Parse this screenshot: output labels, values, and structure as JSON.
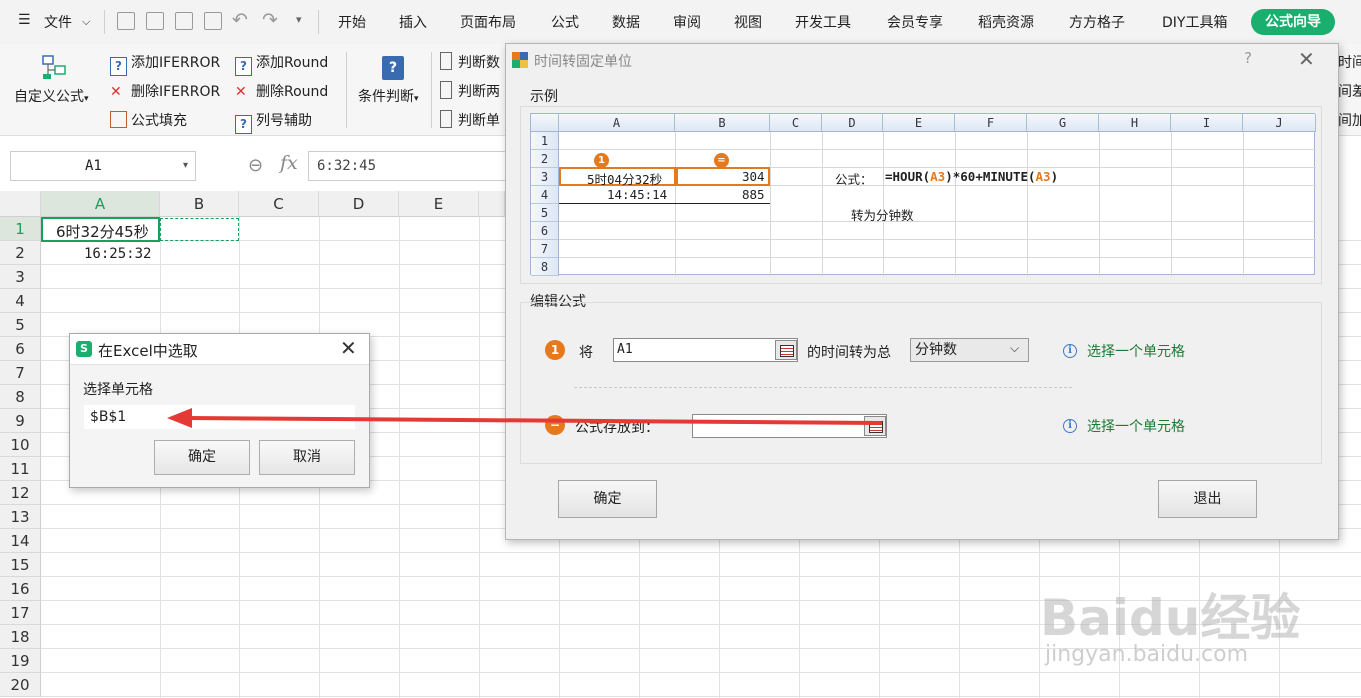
{
  "menubar": {
    "file": "文件",
    "tabs": [
      "开始",
      "插入",
      "页面布局",
      "公式",
      "数据",
      "审阅",
      "视图",
      "开发工具",
      "会员专享",
      "稻壳资源",
      "方方格子",
      "DIY工具箱"
    ],
    "active_tab": "公式向导",
    "accent_color": "#1aae6f"
  },
  "ribbon": {
    "custom_formula": "自定义公式",
    "add_iferror": "添加IFERROR",
    "del_iferror": "删除IFERROR",
    "formula_fill": "公式填充",
    "add_round": "添加Round",
    "del_round": "删除Round",
    "col_helper": "列号辅助",
    "condition": "条件判断",
    "judge1": "判断数",
    "judge2": "判断两",
    "judge3": "判断单",
    "right1": "时间",
    "right2": "间差",
    "right3": "间加"
  },
  "formula_bar": {
    "name_box": "A1",
    "formula": "6:32:45"
  },
  "sheet": {
    "columns": [
      "A",
      "B",
      "C",
      "D",
      "E"
    ],
    "rows": [
      "1",
      "2",
      "3",
      "4",
      "5",
      "6",
      "7",
      "8",
      "9",
      "10",
      "11",
      "12",
      "13",
      "14",
      "15",
      "16",
      "17",
      "18",
      "19",
      "20"
    ],
    "a1": "6时32分45秒",
    "a2": "16:25:32"
  },
  "dialog_main": {
    "title": "时间转固定单位",
    "help": "?",
    "example_label": "示例",
    "example": {
      "columns": [
        "A",
        "B",
        "C",
        "D",
        "E",
        "F",
        "G",
        "H",
        "I",
        "J"
      ],
      "rows": [
        "1",
        "2",
        "3",
        "4",
        "5",
        "6",
        "7",
        "8"
      ],
      "badge1": "1",
      "badge2": "=",
      "a3": "5时04分32秒",
      "b3": "304",
      "a4": "14:45:14",
      "b4": "885",
      "formula_label": "公式：",
      "formula_prefix": "=HOUR(",
      "formula_ref1": "A3",
      "formula_mid": ")*60+MINUTE(",
      "formula_ref2": "A3",
      "formula_suffix": ")",
      "note": "转为分钟数"
    },
    "edit_label": "编辑公式",
    "step1_badge": "1",
    "step1_prefix": "将",
    "step1_input": "A1",
    "step1_suffix": "的时间转为总",
    "unit_selected": "分钟数",
    "hint1": "选择一个单元格",
    "step2_badge": "−",
    "step2_label": "公式存放到：",
    "step2_input": "",
    "hint2": "选择一个单元格",
    "ok": "确定",
    "exit": "退出"
  },
  "dialog_pick": {
    "title": "在Excel中选取",
    "label": "选择单元格",
    "value": "$B$1",
    "ok": "确定",
    "cancel": "取消"
  },
  "watermark": {
    "logo": "Baidu经验",
    "url": "jingyan.baidu.com"
  }
}
